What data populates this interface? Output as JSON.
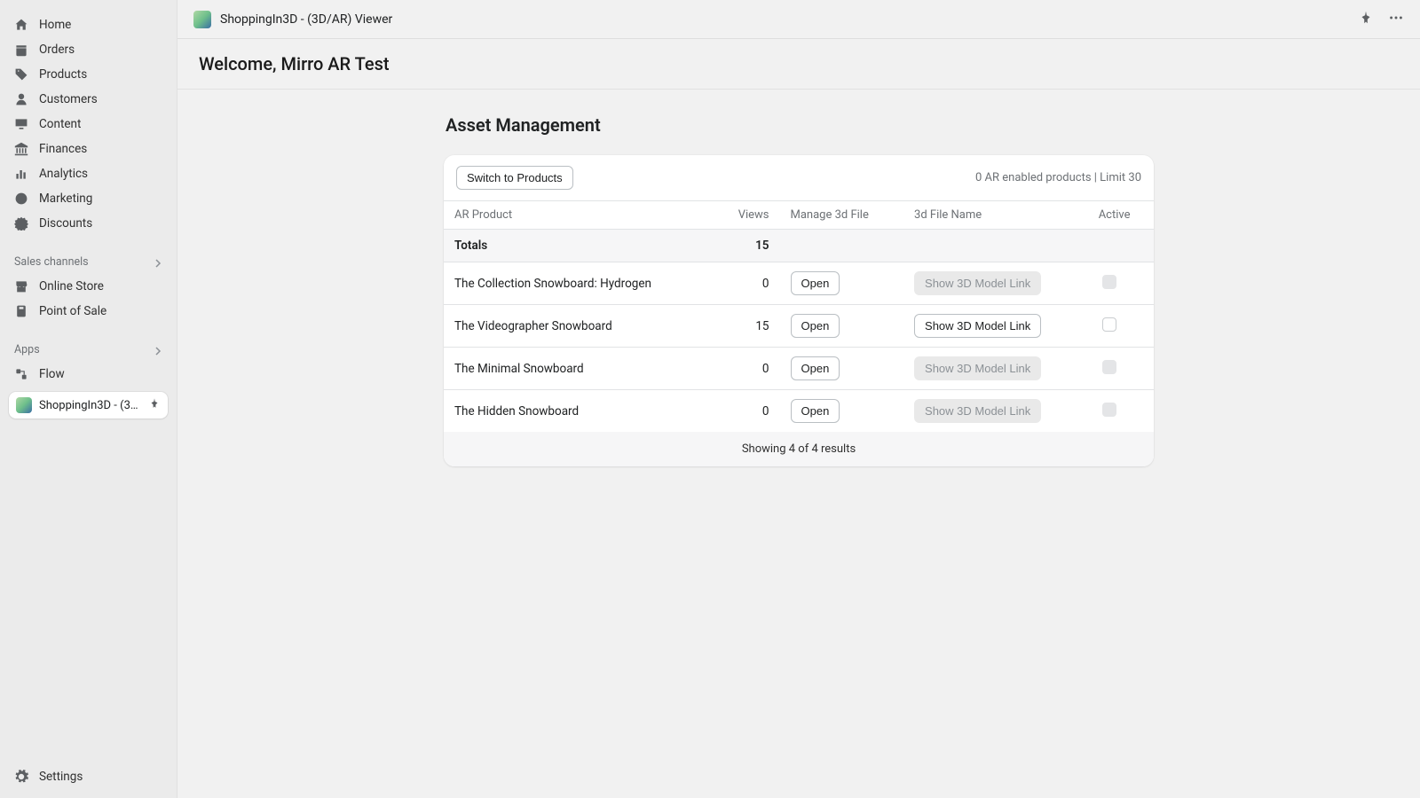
{
  "sidebar": {
    "items": [
      {
        "label": "Home"
      },
      {
        "label": "Orders"
      },
      {
        "label": "Products"
      },
      {
        "label": "Customers"
      },
      {
        "label": "Content"
      },
      {
        "label": "Finances"
      },
      {
        "label": "Analytics"
      },
      {
        "label": "Marketing"
      },
      {
        "label": "Discounts"
      }
    ],
    "sales_header": "Sales channels",
    "sales_items": [
      {
        "label": "Online Store"
      },
      {
        "label": "Point of Sale"
      }
    ],
    "apps_header": "Apps",
    "apps_items": [
      {
        "label": "Flow"
      }
    ],
    "current_app_label": "ShoppingIn3D - (3D/A...",
    "settings_label": "Settings"
  },
  "topbar": {
    "title": "ShoppingIn3D - (3D/AR) Viewer"
  },
  "welcome": "Welcome, Mirro AR Test",
  "page_title": "Asset Management",
  "card": {
    "switch_btn": "Switch to Products",
    "status": "0 AR enabled products | Limit 30",
    "columns": {
      "product": "AR Product",
      "views": "Views",
      "manage": "Manage 3d File",
      "filename": "3d File Name",
      "active": "Active"
    },
    "totals_label": "Totals",
    "totals_views": "15",
    "rows": [
      {
        "name": "The Collection Snowboard: Hydrogen",
        "views": "0",
        "open": "Open",
        "link": "Show 3D Model Link",
        "link_enabled": false,
        "active_enabled": false
      },
      {
        "name": "The Videographer Snowboard",
        "views": "15",
        "open": "Open",
        "link": "Show 3D Model Link",
        "link_enabled": true,
        "active_enabled": true
      },
      {
        "name": "The Minimal Snowboard",
        "views": "0",
        "open": "Open",
        "link": "Show 3D Model Link",
        "link_enabled": false,
        "active_enabled": false
      },
      {
        "name": "The Hidden Snowboard",
        "views": "0",
        "open": "Open",
        "link": "Show 3D Model Link",
        "link_enabled": false,
        "active_enabled": false
      }
    ],
    "footer": "Showing 4 of 4 results"
  }
}
